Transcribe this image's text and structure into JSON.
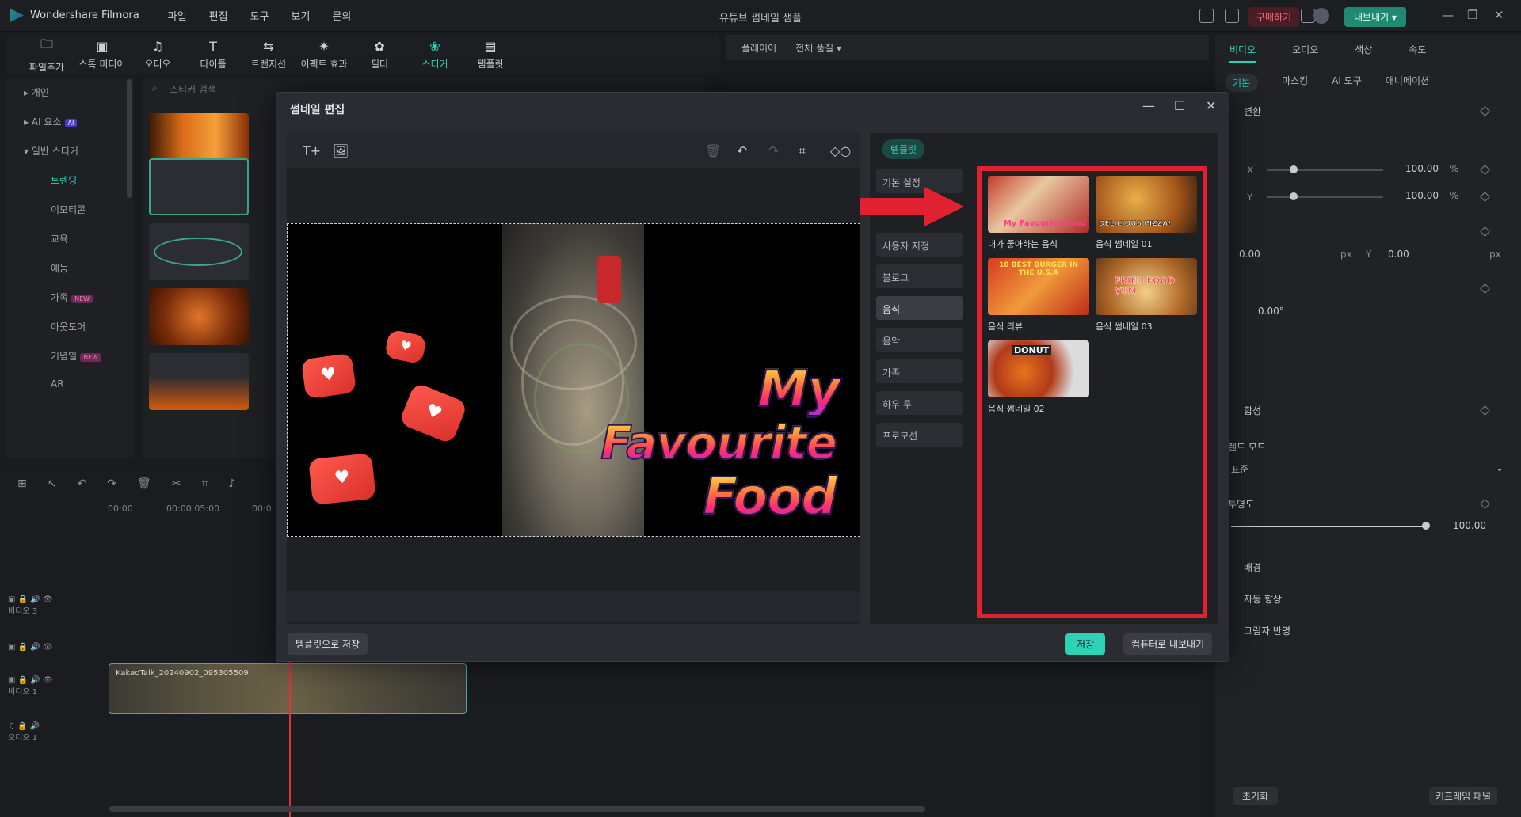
{
  "app": {
    "name": "Wondershare Filmora",
    "title": "유튜브 썸네일 샘플",
    "buy": "구매하기",
    "export": "내보내기"
  },
  "menu": [
    "파일",
    "편집",
    "도구",
    "보기",
    "문의"
  ],
  "toolstrip": [
    {
      "label": "파일추가",
      "icon": "folder-icon"
    },
    {
      "label": "스톡 미디어",
      "icon": "stock-icon"
    },
    {
      "label": "오디오",
      "icon": "music-icon"
    },
    {
      "label": "타이틀",
      "icon": "text-icon"
    },
    {
      "label": "트랜지션",
      "icon": "transition-icon"
    },
    {
      "label": "이펙트 효과",
      "icon": "effect-icon"
    },
    {
      "label": "필터",
      "icon": "filter-icon"
    },
    {
      "label": "스티커",
      "icon": "sticker-icon"
    },
    {
      "label": "템플릿",
      "icon": "template-icon"
    }
  ],
  "leftnav": {
    "items": [
      "개인",
      "AI 요소",
      "일반 스티커",
      "트렌딩",
      "이모티콘",
      "교육",
      "예능",
      "가족",
      "아웃도어",
      "기념일",
      "AR"
    ],
    "ai_badge": "AI",
    "new_badge": "NEW"
  },
  "sticker_search": {
    "placeholder": "스티커 검색"
  },
  "player": {
    "label": "플레이어",
    "quality": "전체 품질"
  },
  "right": {
    "tabs": [
      "비디오",
      "오디오",
      "색상",
      "속도"
    ],
    "subtabs": [
      "기본",
      "마스킹",
      "AI 도구",
      "애니메이션"
    ],
    "transform": "변환",
    "scale_x": "100.00",
    "scale_y": "100.00",
    "pct": "%",
    "pos_x": "0.00",
    "pos_y": "0.00",
    "px": "px",
    "rotate": "0.00°",
    "composite": "합성",
    "blend": "렌드 모드",
    "blend_value": "표준",
    "opacity": "투명도",
    "opacity_value": "100.00",
    "bg": "배경",
    "auto_enhance": "자동 향상",
    "shadow": "그림자 반영",
    "reset": "초기화",
    "keyframe": "키프레임 패널",
    "x": "X",
    "y": "Y"
  },
  "timeline": {
    "t0": "00:00",
    "t1": "00:00:05:00",
    "t2": "00:0",
    "tracks": [
      "비디오 3",
      "",
      "비디오 1",
      "오디오 1"
    ],
    "clip": "KakaoTalk_20240902_095305509"
  },
  "dialog": {
    "title": "썸네일 편집",
    "save_template": "템플릿으로 저장",
    "save": "저장",
    "export_pc": "컴퓨터로 내보내기",
    "template_tab": "템플릿",
    "categories": [
      "기본 설정",
      "사용자 지정",
      "블로그",
      "음식",
      "음악",
      "가족",
      "하우 투",
      "프로모션"
    ],
    "canvas_text": [
      "My",
      "Favourite",
      "Food"
    ],
    "templates": [
      {
        "label": "내가 좋아하는 음식",
        "caption": "My Favourite Food"
      },
      {
        "label": "음식 썸네일 01",
        "caption": "DELICIOUS PIZZA!"
      },
      {
        "label": "음식 리뷰",
        "caption": "10 BEST BURGER IN THE U.S.A"
      },
      {
        "label": "음식 썸네일 03",
        "caption": "FRIED FOOD YUM"
      },
      {
        "label": "음식 썸네일 02",
        "caption": "DONUT"
      }
    ]
  },
  "colors": {
    "accent": "#2ed3b7",
    "highlight": "#e0212f"
  }
}
